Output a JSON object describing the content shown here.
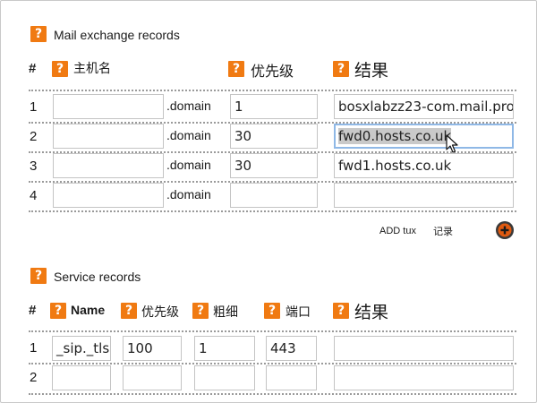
{
  "mx": {
    "title": "Mail exchange records",
    "col_hash": "#",
    "col_host": "主机名",
    "col_priority": "优先级",
    "col_result": "结果",
    "domain_suffix": ".domain",
    "rows": [
      {
        "num": "1",
        "host": "",
        "priority": "1",
        "result": "bosxlabzz23-com.mail.pro"
      },
      {
        "num": "2",
        "host": "",
        "priority": "30",
        "result": "fwd0.hosts.co.uk"
      },
      {
        "num": "3",
        "host": "",
        "priority": "30",
        "result": "fwd1.hosts.co.uk"
      },
      {
        "num": "4",
        "host": "",
        "priority": "",
        "result": ""
      }
    ],
    "add_label_1": "ADD tux",
    "add_label_2": "记录"
  },
  "srv": {
    "title": "Service records",
    "col_hash": "#",
    "col_name": "Name",
    "col_priority": "优先级",
    "col_weight": "粗细",
    "col_port": "端口",
    "col_result": "结果",
    "rows": [
      {
        "num": "1",
        "name": "_sip._tls",
        "priority": "100",
        "weight": "1",
        "port": "443",
        "result": ""
      },
      {
        "num": "2",
        "name": "",
        "priority": "",
        "weight": "",
        "port": "",
        "result": ""
      }
    ]
  },
  "icons": {
    "help": "help-icon",
    "add": "add-circle-icon",
    "cursor": "mouse-pointer-icon"
  },
  "colors": {
    "help_icon": "#f07a12",
    "add_button": "#e05a10",
    "focus_border": "#8fb8e6",
    "dotted_separator": "#9a9a9a"
  }
}
